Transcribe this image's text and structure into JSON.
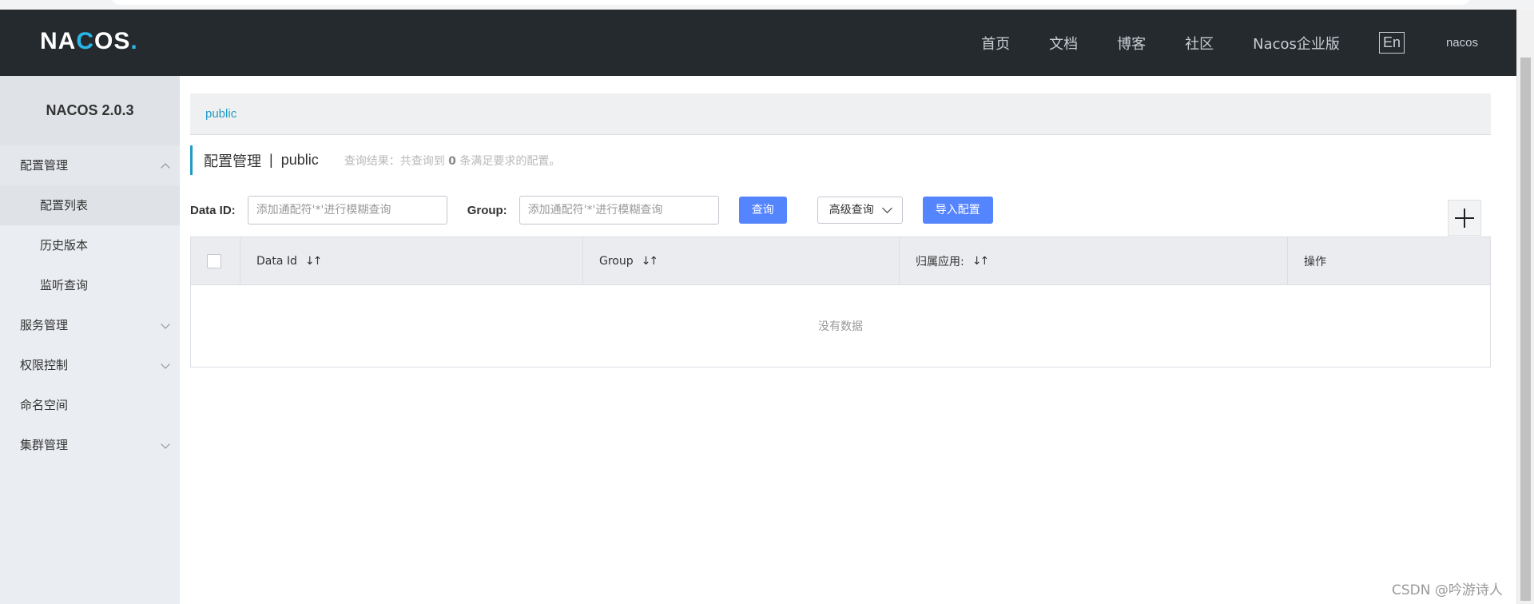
{
  "header": {
    "logo": {
      "part1": "NA",
      "part2": "C",
      "part3": "OS",
      "dot": "."
    },
    "nav": [
      "首页",
      "文档",
      "博客",
      "社区",
      "Nacos企业版"
    ],
    "lang_button": "En",
    "user": "nacos"
  },
  "sidebar": {
    "brand": "NACOS 2.0.3",
    "items": [
      {
        "label": "配置管理",
        "expanded": true
      },
      {
        "label": "配置列表"
      },
      {
        "label": "历史版本"
      },
      {
        "label": "监听查询"
      },
      {
        "label": "服务管理"
      },
      {
        "label": "权限控制"
      },
      {
        "label": "命名空间"
      },
      {
        "label": "集群管理"
      }
    ]
  },
  "main": {
    "namespace_tab": "public",
    "title": "配置管理",
    "title_sep": "|",
    "title_ns": "public",
    "result_prefix": "查询结果：共查询到",
    "result_count": "0",
    "result_suffix": "条满足要求的配置。",
    "search": {
      "dataid_label": "Data ID:",
      "dataid_placeholder": "添加通配符'*'进行模糊查询",
      "group_label": "Group:",
      "group_placeholder": "添加通配符'*'进行模糊查询",
      "query_button": "查询",
      "advanced_button": "高级查询",
      "import_button": "导入配置"
    },
    "table": {
      "columns": [
        "Data Id",
        "Group",
        "归属应用:",
        "操作"
      ],
      "sort_glyph": "↓↑",
      "empty_text": "没有数据"
    }
  },
  "watermark": "CSDN @吟游诗人",
  "colors": {
    "header_bg": "#252a2f",
    "accent": "#209bc4",
    "primary_button": "#5584ff",
    "sidebar_bg": "#eaedf1"
  }
}
